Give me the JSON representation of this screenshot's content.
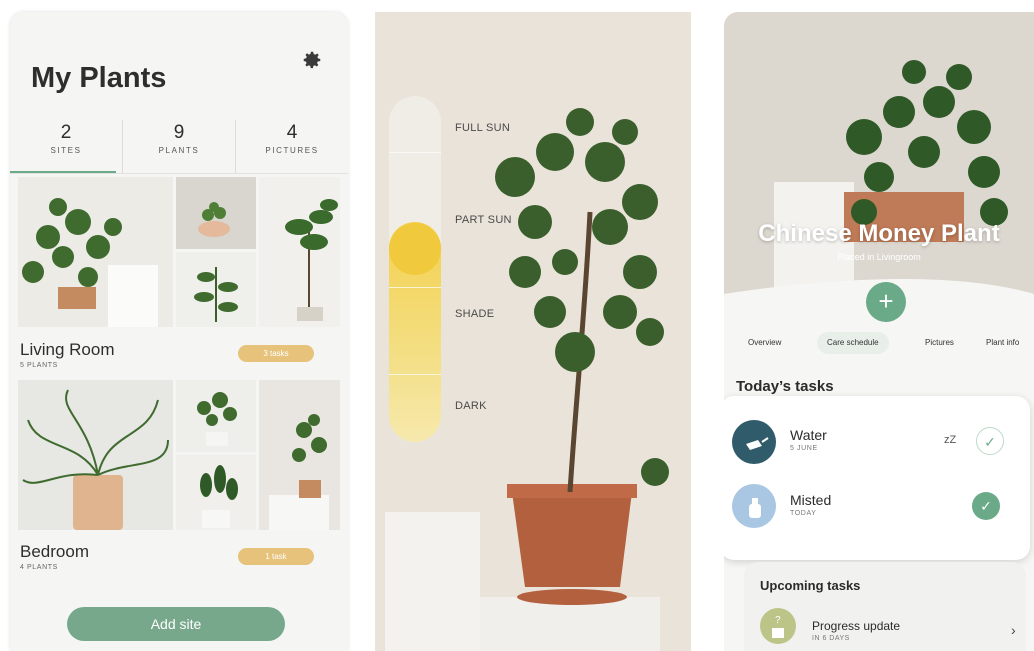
{
  "screen1": {
    "title": "My Plants",
    "stats": [
      {
        "num": "2",
        "label": "SITES"
      },
      {
        "num": "9",
        "label": "PLANTS"
      },
      {
        "num": "4",
        "label": "PICTURES"
      }
    ],
    "sites": [
      {
        "name": "Living Room",
        "count": "5 PLANTS",
        "tasks": "3 tasks"
      },
      {
        "name": "Bedroom",
        "count": "4 PLANTS",
        "tasks": "1 task"
      }
    ],
    "add_site": "Add site"
  },
  "screen2": {
    "light_levels": [
      "FULL SUN",
      "PART SUN",
      "SHADE",
      "DARK"
    ],
    "selected_level": "PART SUN"
  },
  "screen3": {
    "plant_name": "Chinese Money Plant",
    "placed": "Placed in Livingroom",
    "tabs": [
      "Overview",
      "Care schedule",
      "Pictures",
      "Plant info"
    ],
    "active_tab": "Care schedule",
    "today_title": "Today’s tasks",
    "today_tasks": [
      {
        "name": "Water",
        "date": "5 JUNE",
        "snooze": "zZ",
        "done": false
      },
      {
        "name": "Misted",
        "date": "TODAY",
        "done": true
      }
    ],
    "upcoming_title": "Upcoming tasks",
    "upcoming": [
      {
        "name": "Progress update",
        "date": "IN 6 DAYS"
      }
    ]
  },
  "colors": {
    "accent_green": "#6aaa88",
    "task_pill": "#e6c27a",
    "sun_yellow": "#f1c93c",
    "water_blue": "#2f5b6b",
    "mist_blue": "#a9c6e2"
  }
}
